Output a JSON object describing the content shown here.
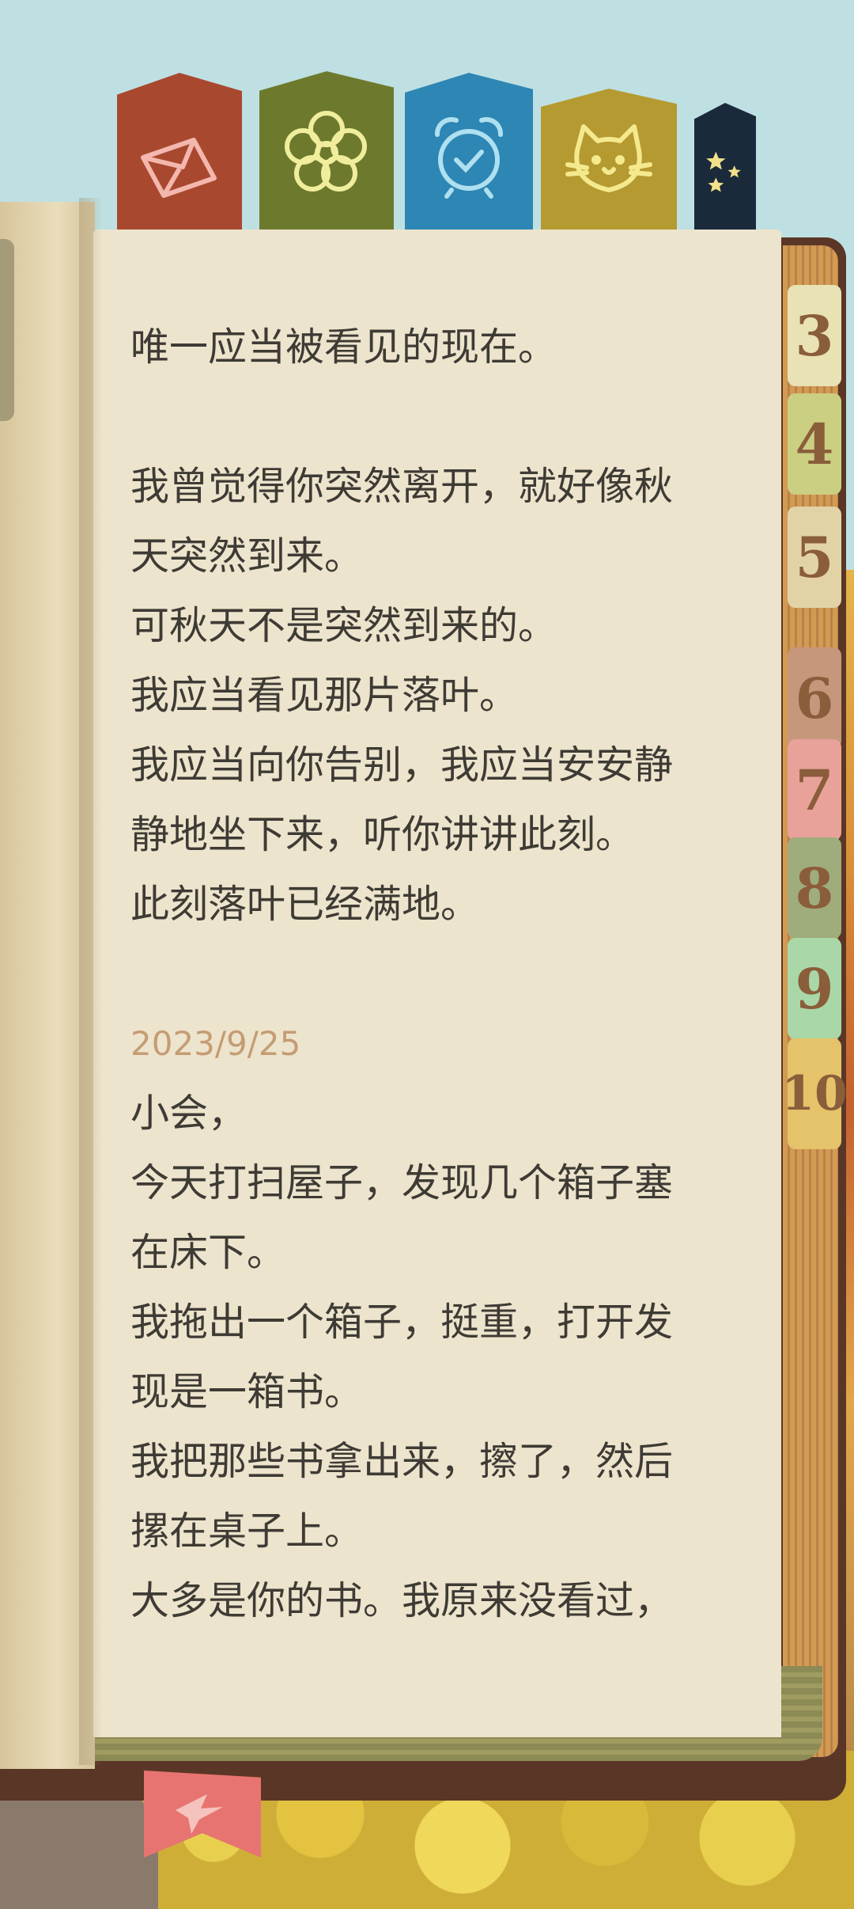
{
  "tabs_top": [
    {
      "name": "envelope",
      "color": "#a8492f",
      "icon": "envelope-icon"
    },
    {
      "name": "flower",
      "color": "#6d7a2e",
      "icon": "flower-icon"
    },
    {
      "name": "alarm",
      "color": "#2d86b4",
      "icon": "alarm-clock-icon"
    },
    {
      "name": "cat",
      "color": "#b59a31",
      "icon": "cat-icon"
    },
    {
      "name": "stars",
      "color": "#1b2a3a",
      "icon": "stars-icon"
    }
  ],
  "tabs_right": [
    {
      "label": "3",
      "color": "#e9e2b4"
    },
    {
      "label": "4",
      "color": "#cbcf82"
    },
    {
      "label": "5",
      "color": "#e2d3a7"
    },
    {
      "label": "6",
      "color": "#c7977c"
    },
    {
      "label": "7",
      "color": "#e8a29a"
    },
    {
      "label": "8",
      "color": "#9fac7b"
    },
    {
      "label": "9",
      "color": "#a9d7a8"
    },
    {
      "label": "10",
      "color": "#e4c36a"
    }
  ],
  "content": {
    "p1": "唯一应当被看见的现在。",
    "p2": [
      "我曾觉得你突然离开，就好像秋",
      "天突然到来。",
      "可秋天不是突然到来的。",
      "我应当看见那片落叶。",
      "我应当向你告别，我应当安安静",
      "静地坐下来，听你讲讲此刻。",
      "此刻落叶已经满地。"
    ],
    "date": "2023/9/25",
    "p3": [
      "小会，",
      "今天打扫屋子，发现几个箱子塞",
      "在床下。",
      "我拖出一个箱子，挺重，打开发",
      "现是一箱书。",
      "我把那些书拿出来，擦了，然后",
      "摞在桌子上。",
      "大多是你的书。我原来没看过，"
    ]
  }
}
